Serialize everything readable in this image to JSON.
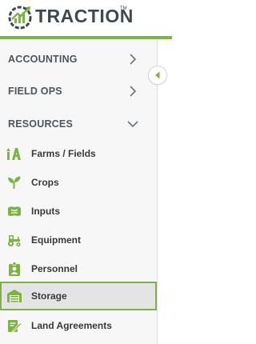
{
  "brand": {
    "name": "TRACTION",
    "trademark": "TM",
    "accent_color": "#7cb342",
    "text_color": "#3d4a52"
  },
  "sidebar": {
    "sections": [
      {
        "label": "ACCOUNTING",
        "state": "collapsed",
        "icon": "chevron-right-icon"
      },
      {
        "label": "FIELD OPS",
        "state": "collapsed",
        "icon": "chevron-right-icon"
      },
      {
        "label": "RESOURCES",
        "state": "expanded",
        "icon": "chevron-down-icon"
      }
    ],
    "items": [
      {
        "label": "Farms / Fields",
        "icon": "farm-fields-icon",
        "active": false
      },
      {
        "label": "Crops",
        "icon": "sprout-icon",
        "active": false
      },
      {
        "label": "Inputs",
        "icon": "inputs-icon",
        "active": false
      },
      {
        "label": "Equipment",
        "icon": "tractor-icon",
        "active": false
      },
      {
        "label": "Personnel",
        "icon": "personnel-badge-icon",
        "active": false
      },
      {
        "label": "Storage",
        "icon": "storage-barn-icon",
        "active": true
      },
      {
        "label": "Land Agreements",
        "icon": "land-agreement-icon",
        "active": false
      }
    ],
    "collapse_button_icon": "triangle-left-icon"
  }
}
